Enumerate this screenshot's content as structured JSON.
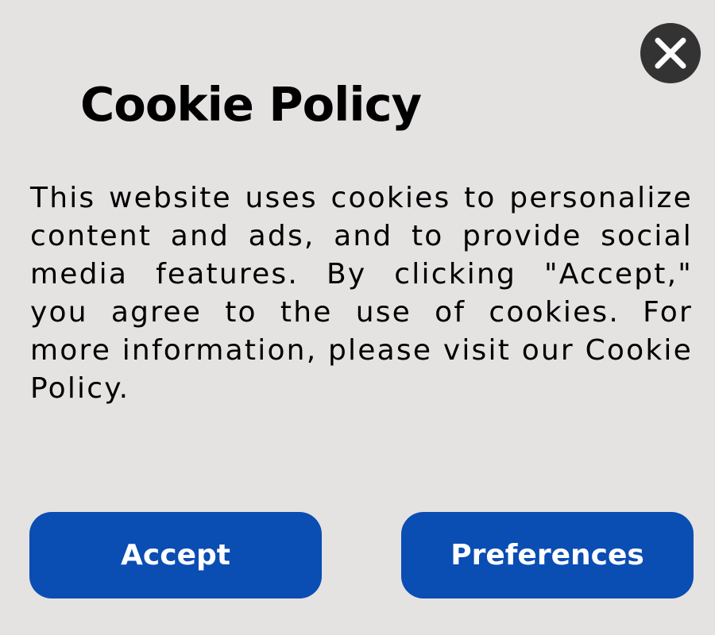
{
  "dialog": {
    "title": "Cookie Policy",
    "body": "This website uses cookies to personalize content and ads, and to provide social media features. By clicking \"Accept,\" you agree to the use of cookies. For more information, please visit our Cookie Policy.",
    "close_icon": "close-icon",
    "accept_label": "Accept",
    "preferences_label": "Preferences"
  },
  "colors": {
    "background": "#e5e2e2",
    "button": "#0a4db3",
    "close_button": "#333333",
    "text": "#000000"
  }
}
